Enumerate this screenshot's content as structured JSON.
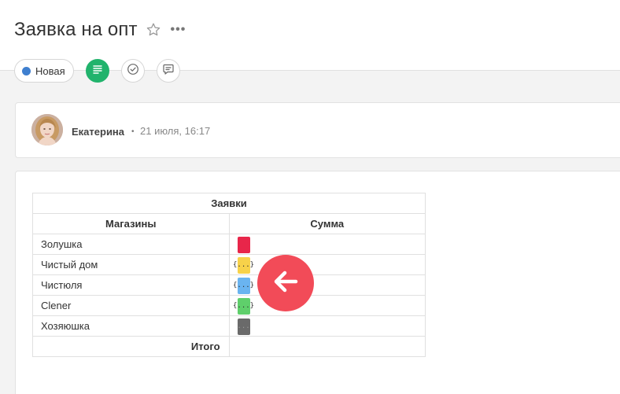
{
  "header": {
    "title": "Заявка на опт",
    "star_icon": "star-outline-icon",
    "more_icon": "more-horizontal-icon",
    "more_label": "•••"
  },
  "actions": {
    "status_label": "Новая",
    "status_color": "#3f7fcf",
    "buttons": [
      {
        "icon": "document-lines-icon",
        "active": true,
        "color": "#21b36c"
      },
      {
        "icon": "check-circle-icon",
        "active": false
      },
      {
        "icon": "comment-icon",
        "active": false
      }
    ]
  },
  "post": {
    "author": "Екатерина",
    "separator": "•",
    "date": "21 июля, 16:17"
  },
  "table": {
    "title": "Заявки",
    "headers": [
      "Магазины",
      "Сумма"
    ],
    "rows": [
      {
        "store": "Золушка",
        "chip_color": "#e8264a",
        "chip_label": ""
      },
      {
        "store": "Чистый дом",
        "chip_color": "#f7d24a",
        "chip_label": "{...}"
      },
      {
        "store": "Чистюля",
        "chip_color": "#6ab4f0",
        "chip_label": "{...}"
      },
      {
        "store": "Clener",
        "chip_color": "#5fcf6b",
        "chip_label": "{...}"
      },
      {
        "store": "Хозяюшка",
        "chip_color": "#6a6a6a",
        "chip_label": "..."
      }
    ],
    "total_label": "Итого"
  },
  "fab": {
    "icon": "arrow-left-icon",
    "color": "#f24b58"
  }
}
